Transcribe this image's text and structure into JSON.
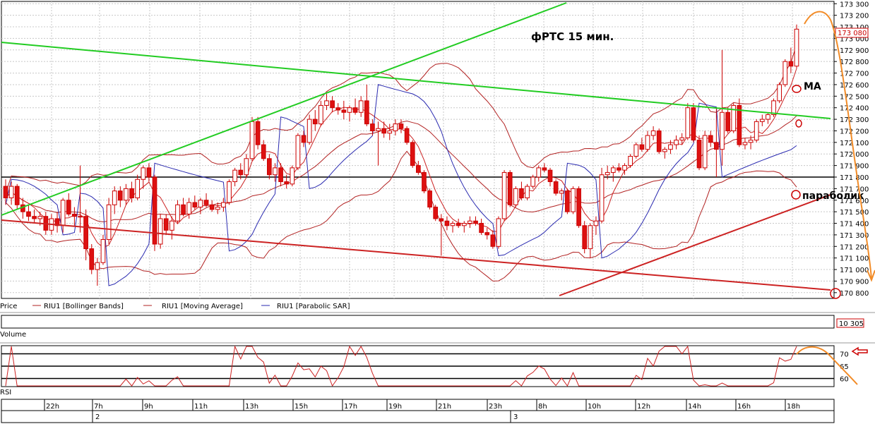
{
  "chart_data": {
    "type": "candlestick",
    "title": "фРТС   15 мин.",
    "instrument": "RIU1",
    "price_axis": {
      "ylim": [
        170750,
        173320
      ],
      "ticks": [
        "173 300",
        "173 200",
        "173 100",
        "173 000",
        "172 900",
        "172 800",
        "172 700",
        "172 600",
        "172 500",
        "172 400",
        "172 300",
        "172 200",
        "172 100",
        "172 000",
        "171 900",
        "171 800",
        "171 700",
        "171 600",
        "171 500",
        "171 400",
        "171 300",
        "171 200",
        "171 100",
        "171 000",
        "170 900",
        "170 800"
      ],
      "tick_values": [
        173300,
        173200,
        173100,
        173000,
        172900,
        172800,
        172700,
        172600,
        172500,
        172400,
        172300,
        172200,
        172100,
        172000,
        171900,
        171800,
        171700,
        171600,
        171500,
        171400,
        171300,
        171200,
        171100,
        171000,
        170900,
        170800
      ],
      "last_price_label": "173 080",
      "last_price": 173080
    },
    "legend": [
      {
        "label": "Price",
        "color": "#cc0000"
      },
      {
        "label": "RIU1 [Bollinger Bands]",
        "color": "#b22222"
      },
      {
        "label": "RIU1 [Moving Average]",
        "color": "#b22222"
      },
      {
        "label": "RIU1 [Parabolic SAR]",
        "color": "#2a2ab0"
      }
    ],
    "time_axis": {
      "hour_labels": [
        "22h",
        "7h",
        "9h",
        "11h",
        "13h",
        "15h",
        "17h",
        "19h",
        "21h",
        "23h",
        "8h",
        "10h",
        "12h",
        "14h",
        "16h",
        "18h"
      ],
      "date_labels": [
        "2",
        "3"
      ]
    },
    "candles": [
      {
        "o": 171720,
        "h": 171780,
        "l": 171560,
        "c": 171620
      },
      {
        "o": 171620,
        "h": 171760,
        "l": 171560,
        "c": 171720
      },
      {
        "o": 171720,
        "h": 171740,
        "l": 171520,
        "c": 171560
      },
      {
        "o": 171560,
        "h": 171620,
        "l": 171440,
        "c": 171500
      },
      {
        "o": 171500,
        "h": 171560,
        "l": 171420,
        "c": 171460
      },
      {
        "o": 171460,
        "h": 171520,
        "l": 171400,
        "c": 171440
      },
      {
        "o": 171440,
        "h": 171500,
        "l": 171380,
        "c": 171460
      },
      {
        "o": 171460,
        "h": 171500,
        "l": 171300,
        "c": 171340
      },
      {
        "o": 171340,
        "h": 171480,
        "l": 171300,
        "c": 171440
      },
      {
        "o": 171440,
        "h": 171500,
        "l": 171320,
        "c": 171380
      },
      {
        "o": 171380,
        "h": 171620,
        "l": 171320,
        "c": 171600
      },
      {
        "o": 171600,
        "h": 171660,
        "l": 171460,
        "c": 171480
      },
      {
        "o": 171480,
        "h": 171540,
        "l": 171380,
        "c": 171460
      },
      {
        "o": 171460,
        "h": 171900,
        "l": 171320,
        "c": 171460
      },
      {
        "o": 171460,
        "h": 171520,
        "l": 171080,
        "c": 171180
      },
      {
        "o": 171180,
        "h": 171220,
        "l": 170960,
        "c": 171000
      },
      {
        "o": 171000,
        "h": 171100,
        "l": 170860,
        "c": 171060
      },
      {
        "o": 171060,
        "h": 171300,
        "l": 171040,
        "c": 171260
      },
      {
        "o": 171260,
        "h": 171620,
        "l": 171220,
        "c": 171560
      },
      {
        "o": 171560,
        "h": 171720,
        "l": 171480,
        "c": 171680
      },
      {
        "o": 171680,
        "h": 171720,
        "l": 171540,
        "c": 171600
      },
      {
        "o": 171600,
        "h": 171740,
        "l": 171560,
        "c": 171700
      },
      {
        "o": 171700,
        "h": 171760,
        "l": 171580,
        "c": 171620
      },
      {
        "o": 171620,
        "h": 171820,
        "l": 171600,
        "c": 171780
      },
      {
        "o": 171780,
        "h": 171900,
        "l": 171700,
        "c": 171880
      },
      {
        "o": 171880,
        "h": 171920,
        "l": 171760,
        "c": 171800
      },
      {
        "o": 171800,
        "h": 171820,
        "l": 171160,
        "c": 171220
      },
      {
        "o": 171220,
        "h": 171480,
        "l": 171180,
        "c": 171440
      },
      {
        "o": 171440,
        "h": 171480,
        "l": 171300,
        "c": 171340
      },
      {
        "o": 171340,
        "h": 171460,
        "l": 171260,
        "c": 171420
      },
      {
        "o": 171420,
        "h": 171600,
        "l": 171400,
        "c": 171560
      },
      {
        "o": 171560,
        "h": 171620,
        "l": 171460,
        "c": 171480
      },
      {
        "o": 171480,
        "h": 171620,
        "l": 171440,
        "c": 171580
      },
      {
        "o": 171580,
        "h": 171640,
        "l": 171520,
        "c": 171540
      },
      {
        "o": 171540,
        "h": 171620,
        "l": 171480,
        "c": 171600
      },
      {
        "o": 171600,
        "h": 171660,
        "l": 171540,
        "c": 171560
      },
      {
        "o": 171560,
        "h": 171600,
        "l": 171500,
        "c": 171520
      },
      {
        "o": 171520,
        "h": 171580,
        "l": 171480,
        "c": 171540
      },
      {
        "o": 171540,
        "h": 171620,
        "l": 171500,
        "c": 171580
      },
      {
        "o": 171580,
        "h": 171780,
        "l": 171560,
        "c": 171760
      },
      {
        "o": 171760,
        "h": 171880,
        "l": 171720,
        "c": 171860
      },
      {
        "o": 171860,
        "h": 171920,
        "l": 171780,
        "c": 171820
      },
      {
        "o": 171820,
        "h": 172000,
        "l": 171800,
        "c": 171960
      },
      {
        "o": 171960,
        "h": 172320,
        "l": 171940,
        "c": 172280
      },
      {
        "o": 172280,
        "h": 172320,
        "l": 172040,
        "c": 172080
      },
      {
        "o": 172080,
        "h": 172120,
        "l": 171940,
        "c": 171960
      },
      {
        "o": 171960,
        "h": 172000,
        "l": 171780,
        "c": 171820
      },
      {
        "o": 171820,
        "h": 171920,
        "l": 171760,
        "c": 171880
      },
      {
        "o": 171880,
        "h": 171920,
        "l": 171720,
        "c": 171760
      },
      {
        "o": 171760,
        "h": 171820,
        "l": 171700,
        "c": 171740
      },
      {
        "o": 171740,
        "h": 171900,
        "l": 171720,
        "c": 171880
      },
      {
        "o": 171880,
        "h": 172180,
        "l": 171860,
        "c": 172160
      },
      {
        "o": 172160,
        "h": 172200,
        "l": 172060,
        "c": 172100
      },
      {
        "o": 172100,
        "h": 172340,
        "l": 172080,
        "c": 172300
      },
      {
        "o": 172300,
        "h": 172380,
        "l": 172200,
        "c": 172260
      },
      {
        "o": 172260,
        "h": 172460,
        "l": 172240,
        "c": 172420
      },
      {
        "o": 172420,
        "h": 172520,
        "l": 172380,
        "c": 172460
      },
      {
        "o": 172460,
        "h": 172500,
        "l": 172360,
        "c": 172400
      },
      {
        "o": 172400,
        "h": 172440,
        "l": 172340,
        "c": 172380
      },
      {
        "o": 172380,
        "h": 172460,
        "l": 172300,
        "c": 172360
      },
      {
        "o": 172360,
        "h": 172420,
        "l": 172280,
        "c": 172400
      },
      {
        "o": 172400,
        "h": 172480,
        "l": 172340,
        "c": 172360
      },
      {
        "o": 172360,
        "h": 172500,
        "l": 172320,
        "c": 172460
      },
      {
        "o": 172460,
        "h": 172600,
        "l": 172240,
        "c": 172260
      },
      {
        "o": 172260,
        "h": 172300,
        "l": 172160,
        "c": 172200
      },
      {
        "o": 172200,
        "h": 172280,
        "l": 171900,
        "c": 172220
      },
      {
        "o": 172220,
        "h": 172280,
        "l": 172140,
        "c": 172180
      },
      {
        "o": 172180,
        "h": 172260,
        "l": 172120,
        "c": 172200
      },
      {
        "o": 172200,
        "h": 172300,
        "l": 172160,
        "c": 172260
      },
      {
        "o": 172260,
        "h": 172300,
        "l": 172180,
        "c": 172220
      },
      {
        "o": 172220,
        "h": 172240,
        "l": 172080,
        "c": 172100
      },
      {
        "o": 172100,
        "h": 172120,
        "l": 171880,
        "c": 171900
      },
      {
        "o": 171900,
        "h": 171940,
        "l": 171820,
        "c": 171840
      },
      {
        "o": 171840,
        "h": 171860,
        "l": 171660,
        "c": 171680
      },
      {
        "o": 171680,
        "h": 171700,
        "l": 171520,
        "c": 171540
      },
      {
        "o": 171540,
        "h": 171560,
        "l": 171420,
        "c": 171440
      },
      {
        "o": 171440,
        "h": 171480,
        "l": 171120,
        "c": 171420
      },
      {
        "o": 171420,
        "h": 171460,
        "l": 171340,
        "c": 171380
      },
      {
        "o": 171380,
        "h": 171420,
        "l": 171320,
        "c": 171400
      },
      {
        "o": 171400,
        "h": 171440,
        "l": 171360,
        "c": 171380
      },
      {
        "o": 171380,
        "h": 171420,
        "l": 171320,
        "c": 171400
      },
      {
        "o": 171400,
        "h": 171460,
        "l": 171360,
        "c": 171420
      },
      {
        "o": 171420,
        "h": 171460,
        "l": 171380,
        "c": 171400
      },
      {
        "o": 171400,
        "h": 171440,
        "l": 171300,
        "c": 171320
      },
      {
        "o": 171320,
        "h": 171360,
        "l": 171260,
        "c": 171300
      },
      {
        "o": 171300,
        "h": 171340,
        "l": 171180,
        "c": 171200
      },
      {
        "o": 171200,
        "h": 171460,
        "l": 171180,
        "c": 171440
      },
      {
        "o": 171440,
        "h": 171860,
        "l": 171420,
        "c": 171840
      },
      {
        "o": 171840,
        "h": 171860,
        "l": 171540,
        "c": 171560
      },
      {
        "o": 171560,
        "h": 171720,
        "l": 171540,
        "c": 171700
      },
      {
        "o": 171700,
        "h": 171760,
        "l": 171600,
        "c": 171620
      },
      {
        "o": 171620,
        "h": 171740,
        "l": 171600,
        "c": 171720
      },
      {
        "o": 171720,
        "h": 171820,
        "l": 171700,
        "c": 171800
      },
      {
        "o": 171800,
        "h": 171900,
        "l": 171760,
        "c": 171880
      },
      {
        "o": 171880,
        "h": 171920,
        "l": 171840,
        "c": 171860
      },
      {
        "o": 171860,
        "h": 171880,
        "l": 171720,
        "c": 171760
      },
      {
        "o": 171760,
        "h": 171780,
        "l": 171640,
        "c": 171660
      },
      {
        "o": 171660,
        "h": 171700,
        "l": 171600,
        "c": 171680
      },
      {
        "o": 171680,
        "h": 171700,
        "l": 171480,
        "c": 171500
      },
      {
        "o": 171500,
        "h": 171720,
        "l": 171480,
        "c": 171700
      },
      {
        "o": 171700,
        "h": 171720,
        "l": 171360,
        "c": 171380
      },
      {
        "o": 171380,
        "h": 171420,
        "l": 171140,
        "c": 171180
      },
      {
        "o": 171180,
        "h": 171400,
        "l": 171100,
        "c": 171380
      },
      {
        "o": 171380,
        "h": 171460,
        "l": 171300,
        "c": 171420
      },
      {
        "o": 171420,
        "h": 171880,
        "l": 171400,
        "c": 171820
      },
      {
        "o": 171820,
        "h": 171900,
        "l": 171780,
        "c": 171840
      },
      {
        "o": 171840,
        "h": 171900,
        "l": 171760,
        "c": 171880
      },
      {
        "o": 171880,
        "h": 171920,
        "l": 171840,
        "c": 171860
      },
      {
        "o": 171860,
        "h": 171920,
        "l": 171820,
        "c": 171900
      },
      {
        "o": 171900,
        "h": 172000,
        "l": 171880,
        "c": 171980
      },
      {
        "o": 171980,
        "h": 172100,
        "l": 171960,
        "c": 172080
      },
      {
        "o": 172080,
        "h": 172140,
        "l": 172020,
        "c": 172040
      },
      {
        "o": 172040,
        "h": 172200,
        "l": 172020,
        "c": 172160
      },
      {
        "o": 172160,
        "h": 172240,
        "l": 172120,
        "c": 172200
      },
      {
        "o": 172200,
        "h": 172220,
        "l": 172000,
        "c": 172020
      },
      {
        "o": 172020,
        "h": 172060,
        "l": 171960,
        "c": 172040
      },
      {
        "o": 172040,
        "h": 172120,
        "l": 172000,
        "c": 172080
      },
      {
        "o": 172080,
        "h": 172160,
        "l": 172040,
        "c": 172120
      },
      {
        "o": 172120,
        "h": 172180,
        "l": 172080,
        "c": 172140
      },
      {
        "o": 172140,
        "h": 172440,
        "l": 172120,
        "c": 172400
      },
      {
        "o": 172400,
        "h": 172440,
        "l": 172100,
        "c": 172120
      },
      {
        "o": 172120,
        "h": 172160,
        "l": 171860,
        "c": 171880
      },
      {
        "o": 171880,
        "h": 172200,
        "l": 171860,
        "c": 172160
      },
      {
        "o": 172160,
        "h": 172200,
        "l": 172060,
        "c": 172100
      },
      {
        "o": 172100,
        "h": 172400,
        "l": 171800,
        "c": 172040
      },
      {
        "o": 172040,
        "h": 172900,
        "l": 171900,
        "c": 172360
      },
      {
        "o": 172360,
        "h": 172400,
        "l": 172180,
        "c": 172200
      },
      {
        "o": 172200,
        "h": 172440,
        "l": 172180,
        "c": 172420
      },
      {
        "o": 172420,
        "h": 172480,
        "l": 172060,
        "c": 172080
      },
      {
        "o": 172080,
        "h": 172140,
        "l": 172040,
        "c": 172100
      },
      {
        "o": 172100,
        "h": 172160,
        "l": 172040,
        "c": 172120
      },
      {
        "o": 172120,
        "h": 172300,
        "l": 172100,
        "c": 172280
      },
      {
        "o": 172280,
        "h": 172340,
        "l": 172240,
        "c": 172300
      },
      {
        "o": 172300,
        "h": 172360,
        "l": 172260,
        "c": 172340
      },
      {
        "o": 172340,
        "h": 172480,
        "l": 172320,
        "c": 172460
      },
      {
        "o": 172460,
        "h": 172620,
        "l": 172440,
        "c": 172600
      },
      {
        "o": 172600,
        "h": 172820,
        "l": 172580,
        "c": 172800
      },
      {
        "o": 172800,
        "h": 172920,
        "l": 172700,
        "c": 172760
      },
      {
        "o": 172760,
        "h": 173120,
        "l": 172740,
        "c": 173080
      }
    ],
    "volume_label": "Volume",
    "volume_value_label": "10 305",
    "rsi_label": "RSI",
    "rsi_axis": {
      "ylim": [
        57,
        73
      ],
      "ticks": [
        "70",
        "65",
        "60"
      ],
      "tick_values": [
        70,
        65,
        60
      ]
    },
    "annotations": [
      {
        "text": "MA"
      },
      {
        "text": "параболик"
      }
    ]
  }
}
